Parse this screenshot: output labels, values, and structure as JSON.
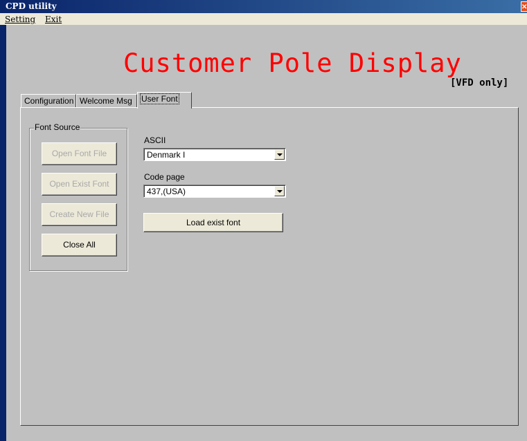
{
  "window": {
    "title": "CPD utility",
    "close_glyph": "✕"
  },
  "menu": {
    "items": [
      "Setting",
      "Exit"
    ]
  },
  "heading": "Customer Pole Display",
  "vfd_note": "[VFD only]",
  "tabs": [
    {
      "label": "Configuration",
      "active": false
    },
    {
      "label": "Welcome Msg",
      "active": false
    },
    {
      "label": "User Font",
      "active": true
    }
  ],
  "font_source": {
    "title": "Font Source",
    "buttons": [
      {
        "label": "Open Font File",
        "enabled": false
      },
      {
        "label": "Open Exist Font",
        "enabled": false
      },
      {
        "label": "Create New File",
        "enabled": false
      },
      {
        "label": "Close All",
        "enabled": true
      }
    ]
  },
  "ascii": {
    "label": "ASCII",
    "value": "Denmark I"
  },
  "code_page": {
    "label": "Code page",
    "value": "437,(USA)"
  },
  "load_button": "Load exist font",
  "colors": {
    "heading": "#ff0000",
    "titlebar": "#0a246a",
    "window_bg": "#c0c0c0"
  }
}
